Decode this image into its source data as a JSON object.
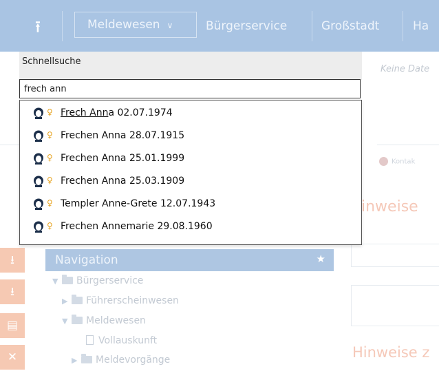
{
  "topbar": {
    "module": "Meldewesen",
    "nav_items": [
      "Bürgerservice",
      "Großstadt",
      "Ha"
    ]
  },
  "quick_search": {
    "label": "Schnellsuche",
    "query": "frech ann",
    "results": [
      {
        "match": "Frech Ann",
        "rest": "a 02.07.1974"
      },
      {
        "match": "",
        "rest": "Frechen Anna 28.07.1915"
      },
      {
        "match": "",
        "rest": "Frechen Anna 25.01.1999"
      },
      {
        "match": "",
        "rest": "Frechen Anna 25.03.1909"
      },
      {
        "match": "",
        "rest": "Templer Anne-Grete 12.07.1943"
      },
      {
        "match": "",
        "rest": "Frechen Annemarie 29.08.1960"
      }
    ]
  },
  "info_panel": {
    "empty_text": "Keine Date",
    "kontakt_label": "Kontak",
    "hinweise_title": "inweise",
    "hinweise_z_title": "Hinweise z"
  },
  "navigation": {
    "title": "Navigation",
    "items": [
      {
        "label": "Bürgerservice"
      },
      {
        "label": "Führerscheinwesen"
      },
      {
        "label": "Meldewesen"
      },
      {
        "label": "Vollauskunft"
      },
      {
        "label": "Meldevorgänge"
      }
    ]
  },
  "colors": {
    "topbar": "#a9c4e3",
    "accent_orange": "#f6c9b3",
    "female_symbol": "#e6a21d"
  },
  "icons": {
    "home": "upload-arrow-icon",
    "person": "person-avatar-icon",
    "female": "female-symbol-icon",
    "star": "star-icon"
  }
}
